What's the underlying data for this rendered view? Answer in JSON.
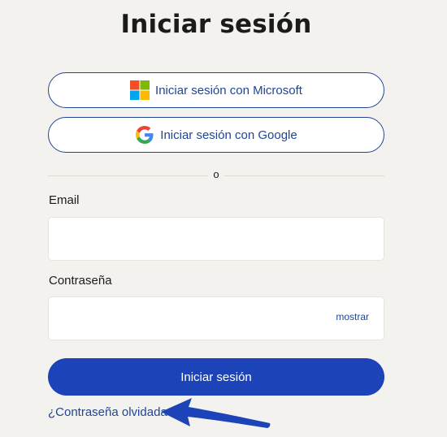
{
  "page": {
    "title": "Iniciar sesión"
  },
  "sso": {
    "microsoft_label": "Iniciar sesión con Microsoft",
    "google_label": "Iniciar sesión con Google"
  },
  "divider": {
    "text": "o"
  },
  "form": {
    "email_label": "Email",
    "email_value": "",
    "password_label": "Contraseña",
    "password_value": "",
    "show_password_label": "mostrar",
    "submit_label": "Iniciar sesión",
    "forgot_password_label": "¿Contraseña olvidada?"
  },
  "colors": {
    "background": "#f4f2ef",
    "accent": "#1c44b8",
    "link": "#1f4592",
    "annotation_arrow": "#1c44b8"
  },
  "icons": {
    "microsoft": "microsoft-logo-icon",
    "google": "google-logo-icon",
    "annotation": "pointer-arrow-icon"
  }
}
